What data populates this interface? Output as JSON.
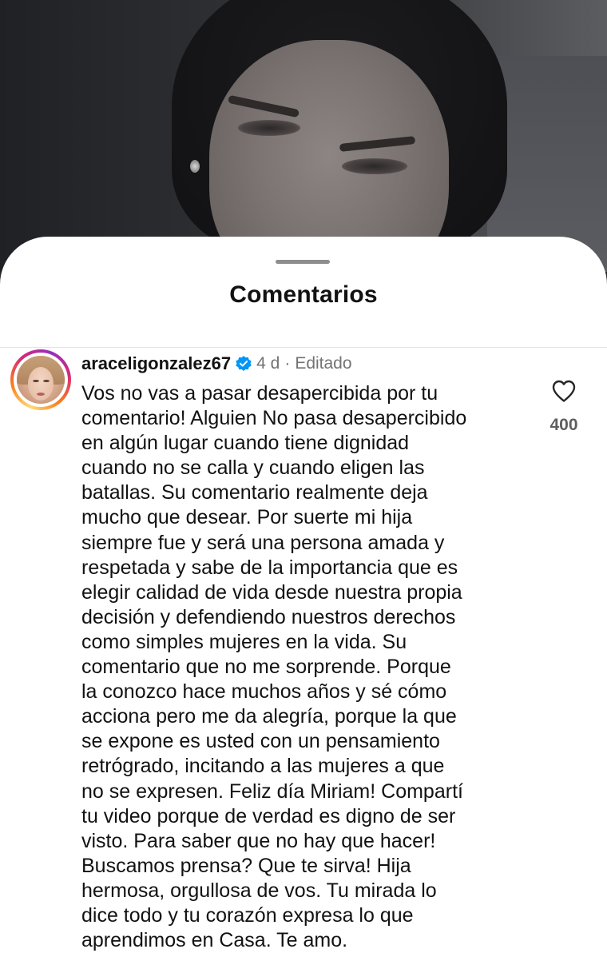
{
  "sheet": {
    "title": "Comentarios"
  },
  "comment": {
    "username": "araceligonzalez67",
    "verified": true,
    "time": "4 d",
    "separator": "·",
    "edited": "Editado",
    "lines": [
      "Vos no vas a pasar desapercibida por tu",
      "comentario! Alguien No pasa desapercibido",
      "en algún lugar cuando tiene dignidad",
      "cuando no se calla y cuando eligen las",
      "batallas. Su comentario realmente deja",
      "mucho que desear. Por suerte mi hija",
      "siempre fue y será una persona amada y",
      "respetada y sabe de la importancia que es",
      "elegir calidad de vida desde nuestra propia",
      "decisión y defendiendo nuestros derechos",
      "como simples mujeres en la vida. Su",
      "comentario que no me sorprende. Porque",
      "la conozco hace muchos años y sé cómo",
      "acciona pero me da alegría, porque la que",
      "se expone es usted con un pensamiento",
      "retrógrado, incitando a las mujeres a que",
      "no se expresen. Feliz día Miriam! Compartí",
      "tu video porque de verdad es digno de ser",
      "visto. Para saber que no hay que hacer!",
      "Buscamos prensa? Que te sirva! Hija",
      "hermosa, orgullosa de vos. Tu mirada lo",
      "dice todo y tu corazón expresa lo que",
      "aprendimos en Casa. Te amo."
    ],
    "likes": "400"
  },
  "colors": {
    "verified_blue": "#0095f6",
    "text_primary": "#121212",
    "text_secondary": "#737373"
  },
  "icons": {
    "like": "heart-outline-icon",
    "verified": "verified-badge-icon"
  }
}
